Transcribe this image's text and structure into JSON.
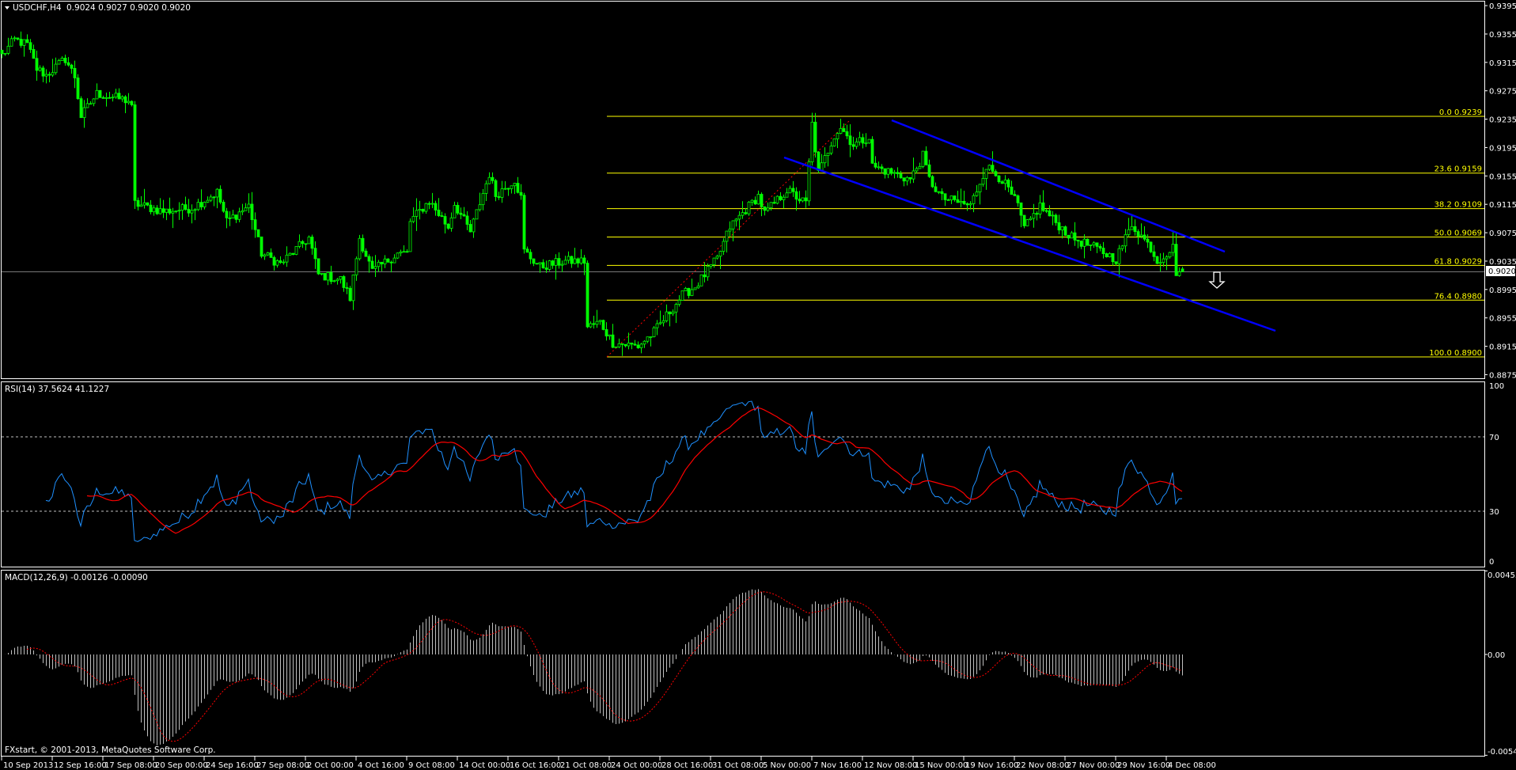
{
  "header": {
    "symbol_label": "USDCHF,H4",
    "ohlc": "0.9024 0.9027 0.9020 0.9020",
    "rsi_label": "RSI(14) 37.5624 41.1227",
    "macd_label": "MACD(12,26,9) -0.00126 -0.00090",
    "copyright": "FXstart, © 2001-2013, MetaQuotes Software Corp."
  },
  "colors": {
    "background": "#000000",
    "candle": "#00ff00",
    "fib": "#ffff00",
    "channel": "#0000ff",
    "rsi": "#1e90ff",
    "rsi_ma": "#ff0000",
    "macd_hist": "#c0c0c0",
    "macd_signal": "#ff0000",
    "current_price_line": "#808080"
  },
  "chart_data": [
    {
      "type": "candlestick",
      "title": "USDCHF,H4",
      "current_price": "0.9020",
      "last_bar": {
        "open": 0.9024,
        "high": 0.9027,
        "low": 0.902,
        "close": 0.902
      },
      "ylim": [
        0.8875,
        0.9395
      ],
      "y_ticks": [
        "0.9395",
        "0.9355",
        "0.9315",
        "0.9275",
        "0.9235",
        "0.9195",
        "0.9155",
        "0.9115",
        "0.9075",
        "0.9035",
        "0.8995",
        "0.8955",
        "0.8915",
        "0.8875"
      ],
      "y_tick_values": [
        0.9395,
        0.9355,
        0.9315,
        0.9275,
        0.9235,
        0.9195,
        0.9155,
        0.9115,
        0.9075,
        0.9035,
        0.8995,
        0.8955,
        0.8915,
        0.8875
      ],
      "bar_count": 374,
      "close_waypoints_bar_price": [
        [
          0,
          0.9325
        ],
        [
          4,
          0.9347
        ],
        [
          8,
          0.934
        ],
        [
          11,
          0.9306
        ],
        [
          14,
          0.9297
        ],
        [
          20,
          0.932
        ],
        [
          23,
          0.9295
        ],
        [
          25,
          0.9239
        ],
        [
          30,
          0.9271
        ],
        [
          40,
          0.9261
        ],
        [
          41,
          0.925
        ],
        [
          42,
          0.9116
        ],
        [
          51,
          0.9105
        ],
        [
          60,
          0.911
        ],
        [
          68,
          0.9132
        ],
        [
          71,
          0.9091
        ],
        [
          78,
          0.9113
        ],
        [
          82,
          0.9046
        ],
        [
          88,
          0.9031
        ],
        [
          97,
          0.9068
        ],
        [
          100,
          0.9016
        ],
        [
          107,
          0.9009
        ],
        [
          110,
          0.8983
        ],
        [
          113,
          0.9068
        ],
        [
          117,
          0.902
        ],
        [
          125,
          0.9046
        ],
        [
          128,
          0.9046
        ],
        [
          129,
          0.9091
        ],
        [
          135,
          0.912
        ],
        [
          141,
          0.9083
        ],
        [
          143,
          0.9116
        ],
        [
          148,
          0.9076
        ],
        [
          154,
          0.9158
        ],
        [
          156,
          0.9128
        ],
        [
          162,
          0.915
        ],
        [
          164,
          0.9124
        ],
        [
          165,
          0.9049
        ],
        [
          170,
          0.9027
        ],
        [
          178,
          0.9035
        ],
        [
          184,
          0.9035
        ],
        [
          185,
          0.8942
        ],
        [
          189,
          0.8949
        ],
        [
          193,
          0.892
        ],
        [
          201,
          0.8915
        ],
        [
          206,
          0.8935
        ],
        [
          215,
          0.8987
        ],
        [
          219,
          0.8999
        ],
        [
          226,
          0.9038
        ],
        [
          230,
          0.9083
        ],
        [
          239,
          0.9127
        ],
        [
          241,
          0.9102
        ],
        [
          248,
          0.9135
        ],
        [
          254,
          0.9116
        ],
        [
          256,
          0.9228
        ],
        [
          258,
          0.9158
        ],
        [
          263,
          0.9213
        ],
        [
          265,
          0.9224
        ],
        [
          269,
          0.9199
        ],
        [
          274,
          0.921
        ],
        [
          275,
          0.9169
        ],
        [
          282,
          0.9158
        ],
        [
          287,
          0.915
        ],
        [
          291,
          0.9183
        ],
        [
          293,
          0.915
        ],
        [
          297,
          0.9124
        ],
        [
          306,
          0.9113
        ],
        [
          311,
          0.9169
        ],
        [
          316,
          0.915
        ],
        [
          321,
          0.9113
        ],
        [
          323,
          0.908
        ],
        [
          328,
          0.9113
        ],
        [
          332,
          0.9094
        ],
        [
          338,
          0.9068
        ],
        [
          345,
          0.9054
        ],
        [
          352,
          0.9038
        ],
        [
          357,
          0.9087
        ],
        [
          363,
          0.9054
        ],
        [
          365,
          0.9035
        ],
        [
          370,
          0.9054
        ],
        [
          371,
          0.902
        ],
        [
          373,
          0.902
        ]
      ],
      "fibonacci": [
        {
          "level": "0.0",
          "price": 0.9239,
          "label": "0.0  0.9239"
        },
        {
          "level": "23.6",
          "price": 0.9159,
          "label": "23.6  0.9159"
        },
        {
          "level": "38.2",
          "price": 0.9109,
          "label": "38.2  0.9109"
        },
        {
          "level": "50.0",
          "price": 0.9069,
          "label": "50.0  0.9069"
        },
        {
          "level": "61.8",
          "price": 0.9029,
          "label": "61.8  0.9029"
        },
        {
          "level": "76.4",
          "price": 0.898,
          "label": "76.4  0.8980"
        },
        {
          "level": "100.0",
          "price": 0.89,
          "label": "100.0  0.8900"
        }
      ],
      "x_ticks": [
        "10 Sep 2013",
        "12 Sep 16:00",
        "17 Sep 08:00",
        "20 Sep 00:00",
        "24 Sep 16:00",
        "27 Sep 08:00",
        "2 Oct 00:00",
        "4 Oct 16:00",
        "9 Oct 08:00",
        "14 Oct 00:00",
        "16 Oct 16:00",
        "21 Oct 08:00",
        "24 Oct 00:00",
        "28 Oct 16:00",
        "31 Oct 08:00",
        "5 Nov 00:00",
        "7 Nov 16:00",
        "12 Nov 08:00",
        "15 Nov 00:00",
        "19 Nov 16:00",
        "22 Nov 08:00",
        "27 Nov 00:00",
        "29 Nov 16:00",
        "4 Dec 08:00"
      ]
    },
    {
      "type": "line",
      "title": "RSI(14)",
      "values_shown": [
        "37.5624",
        "41.1227"
      ],
      "ylim": [
        0,
        100
      ],
      "y_ticks": [
        "100",
        "70",
        "30",
        "0"
      ],
      "levels": [
        70,
        30
      ],
      "series": [
        {
          "name": "RSI(14)"
        },
        {
          "name": "RSI MA"
        }
      ]
    },
    {
      "type": "bar",
      "title": "MACD(12,26,9)",
      "values_shown": [
        "-0.00126",
        "-0.00090"
      ],
      "ylim": [
        -0.00549,
        0.00455
      ],
      "y_ticks": [
        "0.00455",
        "0.00",
        "-0.00549"
      ],
      "series": [
        {
          "name": "MACD histogram"
        },
        {
          "name": "Signal"
        }
      ]
    }
  ]
}
